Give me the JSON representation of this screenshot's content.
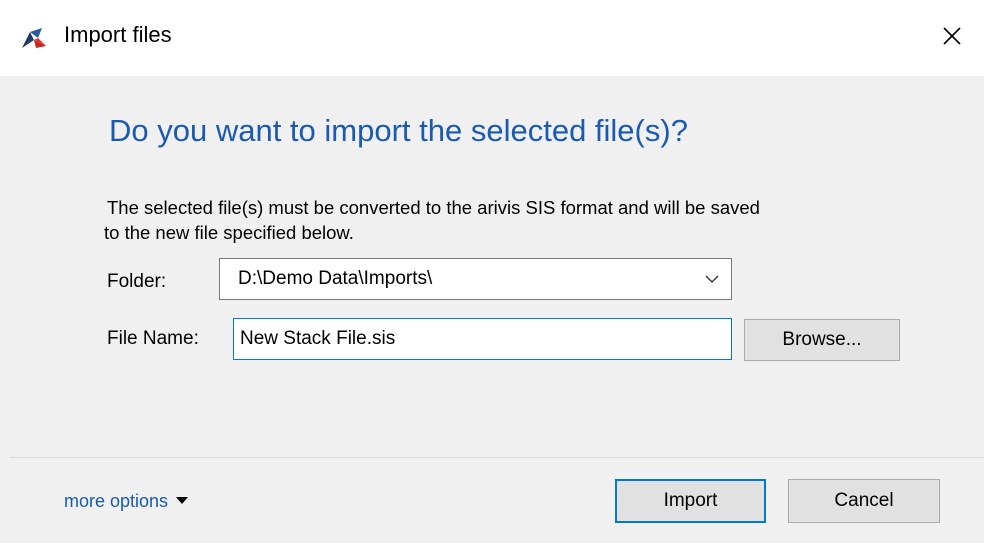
{
  "window": {
    "title": "Import files",
    "app_icon": "arivis-logo-icon",
    "close_icon": "close-icon"
  },
  "content": {
    "heading": "Do you want to import the selected file(s)?",
    "description_line1": "The selected file(s) must be converted to the arivis SIS format and will be saved",
    "description_line2": "to the new file specified below."
  },
  "form": {
    "folder_label": "Folder:",
    "folder_value": "D:\\Demo Data\\Imports\\",
    "filename_label": "File Name:",
    "filename_value": "New Stack File.sis",
    "browse_label": "Browse..."
  },
  "footer": {
    "more_options_label": "more options",
    "import_label": "Import",
    "cancel_label": "Cancel"
  },
  "colors": {
    "accent": "#0078d7",
    "heading": "#1a5ab0",
    "background": "#f0f0f0"
  }
}
